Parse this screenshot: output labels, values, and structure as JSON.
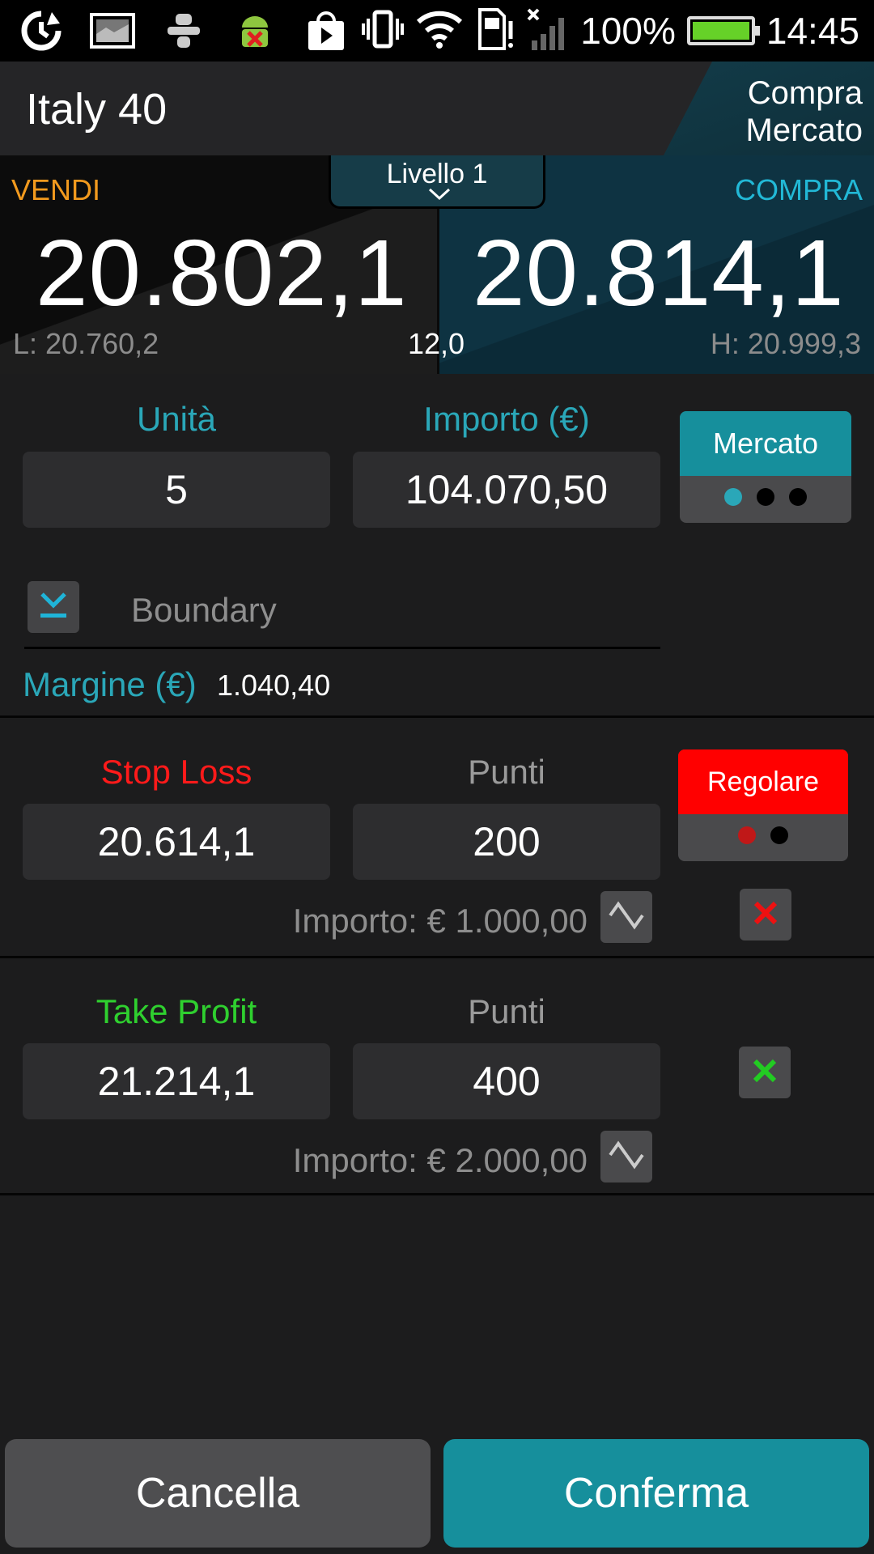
{
  "status_bar": {
    "battery_percent_text": "100%",
    "battery_level": 1.0,
    "time": "14:45",
    "icons": [
      "sync-icon",
      "image-icon",
      "plug-icon",
      "android-debug-icon",
      "play-store-icon",
      "vibrate-icon",
      "wifi-icon",
      "sd-card-alert-icon",
      "no-signal-icon",
      "battery-icon"
    ]
  },
  "header": {
    "title": "Italy 40",
    "mode_line1": "Compra",
    "mode_line2": "Mercato"
  },
  "prices": {
    "sell_label": "VENDI",
    "buy_label": "COMPRA",
    "sell_price": "20.802,1",
    "buy_price": "20.814,1",
    "low": "L: 20.760,2",
    "high": "H: 20.999,3",
    "spread": "12,0",
    "level": "Livello 1"
  },
  "order": {
    "units_label": "Unità",
    "units_value": "5",
    "amount_label": "Importo (€)",
    "amount_value": "104.070,50",
    "type_label": "Mercato",
    "boundary_label": "Boundary",
    "margin_label": "Margine (€)",
    "margin_value": "1.040,40"
  },
  "stop_loss": {
    "label": "Stop Loss",
    "value": "20.614,1",
    "points_label": "Punti",
    "points_value": "200",
    "amount": "Importo: € 1.000,00",
    "type_label": "Regolare"
  },
  "take_profit": {
    "label": "Take Profit",
    "value": "21.214,1",
    "points_label": "Punti",
    "points_value": "400",
    "amount": "Importo: € 2.000,00"
  },
  "buttons": {
    "cancel": "Cancella",
    "confirm": "Conferma"
  },
  "colors": {
    "accent_teal": "#2aa7b8",
    "sell_orange": "#f29a1e",
    "buy_cyan": "#22b8d6",
    "stop_red": "#ff0000",
    "profit_green": "#2fd02f",
    "confirm_bg": "#168f9c"
  }
}
